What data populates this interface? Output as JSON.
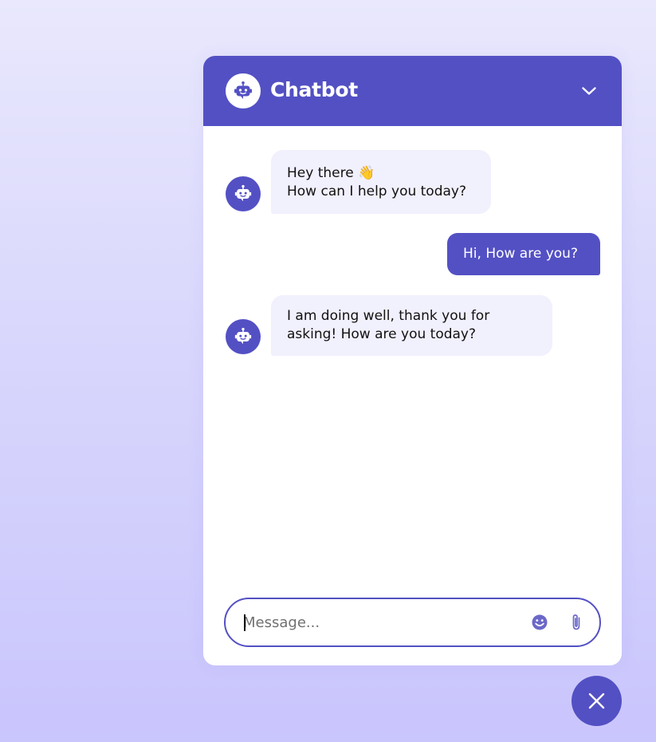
{
  "header": {
    "title": "Chatbot",
    "logo_icon": "robot-icon",
    "toggle_icon": "chevron-down-icon"
  },
  "messages": [
    {
      "sender": "bot",
      "lines": [
        "Hey there 👋",
        "How can I help you today?"
      ]
    },
    {
      "sender": "user",
      "lines": [
        "Hi, How are you?"
      ]
    },
    {
      "sender": "bot",
      "lines": [
        "I am doing well, thank you for",
        "asking! How are you today?"
      ]
    }
  ],
  "composer": {
    "placeholder": "Message...",
    "value": "",
    "emoji_icon": "smiley-icon",
    "attach_icon": "paperclip-icon"
  },
  "close_button": {
    "icon": "close-icon"
  },
  "colors": {
    "accent": "#5350c4",
    "bot_bubble": "#f1f0fd",
    "panel": "#ffffff",
    "background_top": "#e9e8fd",
    "background_bottom": "#c9c5fd"
  }
}
